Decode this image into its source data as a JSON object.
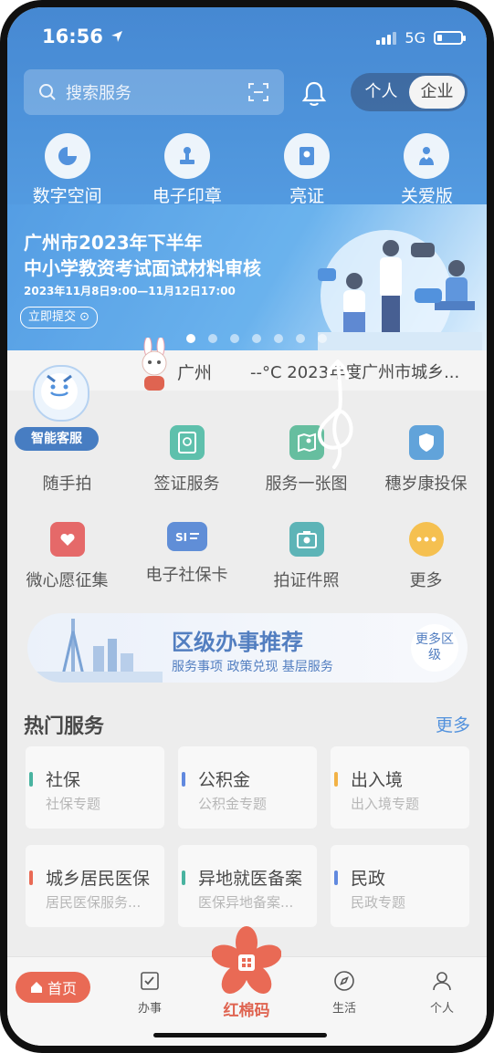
{
  "status_bar": {
    "time": "16:56",
    "network": "5G"
  },
  "header": {
    "search_placeholder": "搜索服务",
    "toggle": {
      "personal": "个人",
      "enterprise": "企业",
      "selected": "企业"
    }
  },
  "quick_actions": [
    {
      "label": "数字空间",
      "icon": "chart-icon"
    },
    {
      "label": "电子印章",
      "icon": "stamp-icon"
    },
    {
      "label": "亮证",
      "icon": "certificate-icon"
    },
    {
      "label": "关爱版",
      "icon": "heart-person-icon"
    }
  ],
  "banner": {
    "line1": "广州市2023年下半年",
    "line2": "中小学教资考试面试材料审核",
    "date": "2023年11月8日9:00—11月12日17:00",
    "button": "立即提交 ⊙",
    "slide_count": 7,
    "active_slide": 0
  },
  "ticker": {
    "city": "广州",
    "text": "--°C 2023年度广州市城乡..."
  },
  "customer_service": {
    "label": "智能客服"
  },
  "services": [
    [
      {
        "label": "随手拍",
        "icon": "camera-app-icon",
        "color": "#e8e8e8"
      },
      {
        "label": "签证服务",
        "icon": "passport-icon",
        "color": "#3bb39a"
      },
      {
        "label": "服务一张图",
        "icon": "map-icon",
        "color": "#45b08a"
      },
      {
        "label": "穗岁康投保",
        "icon": "shield-icon",
        "color": "#3f8fd2"
      }
    ],
    [
      {
        "label": "微心愿征集",
        "icon": "wish-icon",
        "color": "#e04848"
      },
      {
        "label": "电子社保卡",
        "icon": "si-card-icon",
        "color": "#3e76cf"
      },
      {
        "label": "拍证件照",
        "icon": "id-photo-icon",
        "color": "#3aa4a8"
      },
      {
        "label": "更多",
        "icon": "more-dots-icon",
        "color": "#f3b32a"
      }
    ]
  ],
  "district": {
    "title": "区级办事推荐",
    "subtitle": "服务事项  政策兑现  基层服务",
    "more": "更多区级"
  },
  "hot_services": {
    "title": "热门服务",
    "more": "更多",
    "items": [
      {
        "title": "社保",
        "subtitle": "社保专题",
        "color": "#21a38b"
      },
      {
        "title": "公积金",
        "subtitle": "公积金专题",
        "color": "#3f6fd8"
      },
      {
        "title": "出入境",
        "subtitle": "出入境专题",
        "color": "#f0a21e"
      },
      {
        "title": "城乡居民医保",
        "subtitle": "居民医保服务...",
        "color": "#e44a30"
      },
      {
        "title": "异地就医备案",
        "subtitle": "医保异地备案...",
        "color": "#21a38b"
      },
      {
        "title": "民政",
        "subtitle": "民政专题",
        "color": "#3f6fd8"
      }
    ]
  },
  "tabbar": {
    "home": "首页",
    "affairs": "办事",
    "center": "红棉码",
    "life": "生活",
    "personal": "个人"
  }
}
